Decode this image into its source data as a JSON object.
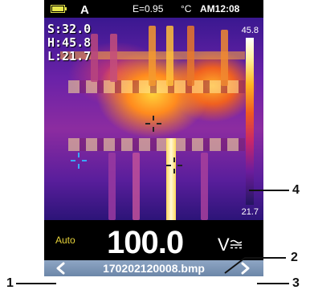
{
  "status_bar": {
    "mode_letter": "A",
    "emissivity": "E=0.95",
    "temp_unit": "°C",
    "clock": "AM12:08"
  },
  "readouts": {
    "spot": "S:32.0",
    "high": "H:45.8",
    "low": "L:21.7"
  },
  "color_scale": {
    "max": "45.8",
    "min": "21.7"
  },
  "reading": {
    "range_mode": "Auto",
    "value": "100.0",
    "unit": "V"
  },
  "file_bar": {
    "prev_icon": "chevron-left",
    "filename": "170202120008.bmp",
    "next_icon": "chevron-right"
  },
  "callouts": {
    "c1": "1",
    "c2": "2",
    "c3": "3",
    "c4": "4"
  },
  "colors": {
    "status_yellow": "#e6e64a",
    "auto_label": "#e6d23a",
    "file_bar": "#7a94b6"
  }
}
